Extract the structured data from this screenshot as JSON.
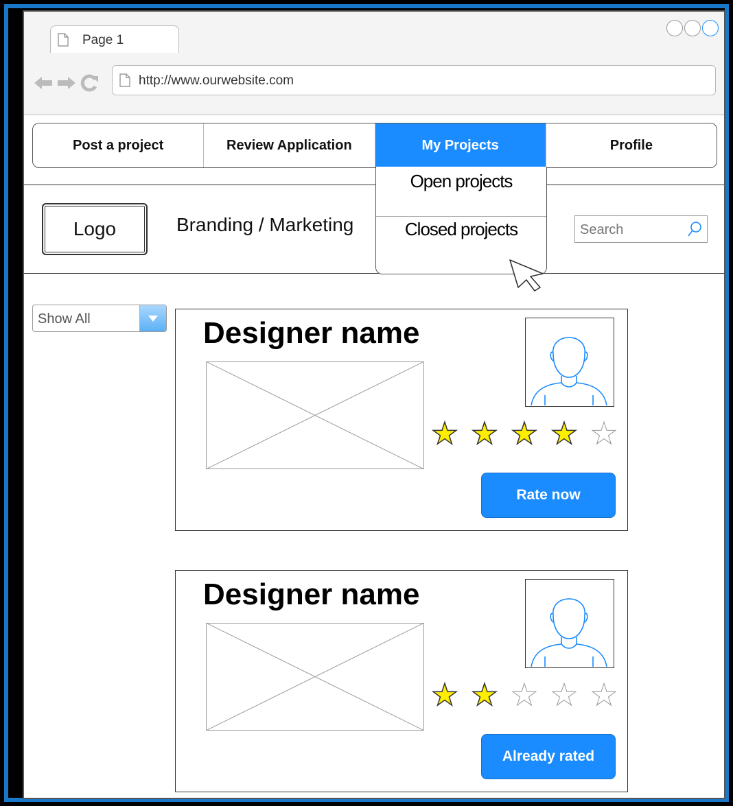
{
  "browser": {
    "tab_label": "Page 1",
    "url": "http://www.ourwebsite.com"
  },
  "menu": {
    "items": [
      {
        "label": "Post a project",
        "active": false
      },
      {
        "label": "Review Application",
        "active": false
      },
      {
        "label": "My Projects",
        "active": true
      },
      {
        "label": "Profile",
        "active": false
      }
    ],
    "dropdown": [
      "Open projects",
      "Closed projects"
    ]
  },
  "header": {
    "logo": "Logo",
    "branding": "Branding / Marketing",
    "search_placeholder": "Search"
  },
  "filter": {
    "selected": "Show All"
  },
  "cards": [
    {
      "designer": "Designer name",
      "rating": 4,
      "max_rating": 5,
      "button": "Rate now"
    },
    {
      "designer": "Designer name",
      "rating": 2,
      "max_rating": 5,
      "button": "Already rated"
    }
  ],
  "colors": {
    "accent": "#1a8cff",
    "star": "#ffee00",
    "frame_border": "#1a78c8"
  }
}
